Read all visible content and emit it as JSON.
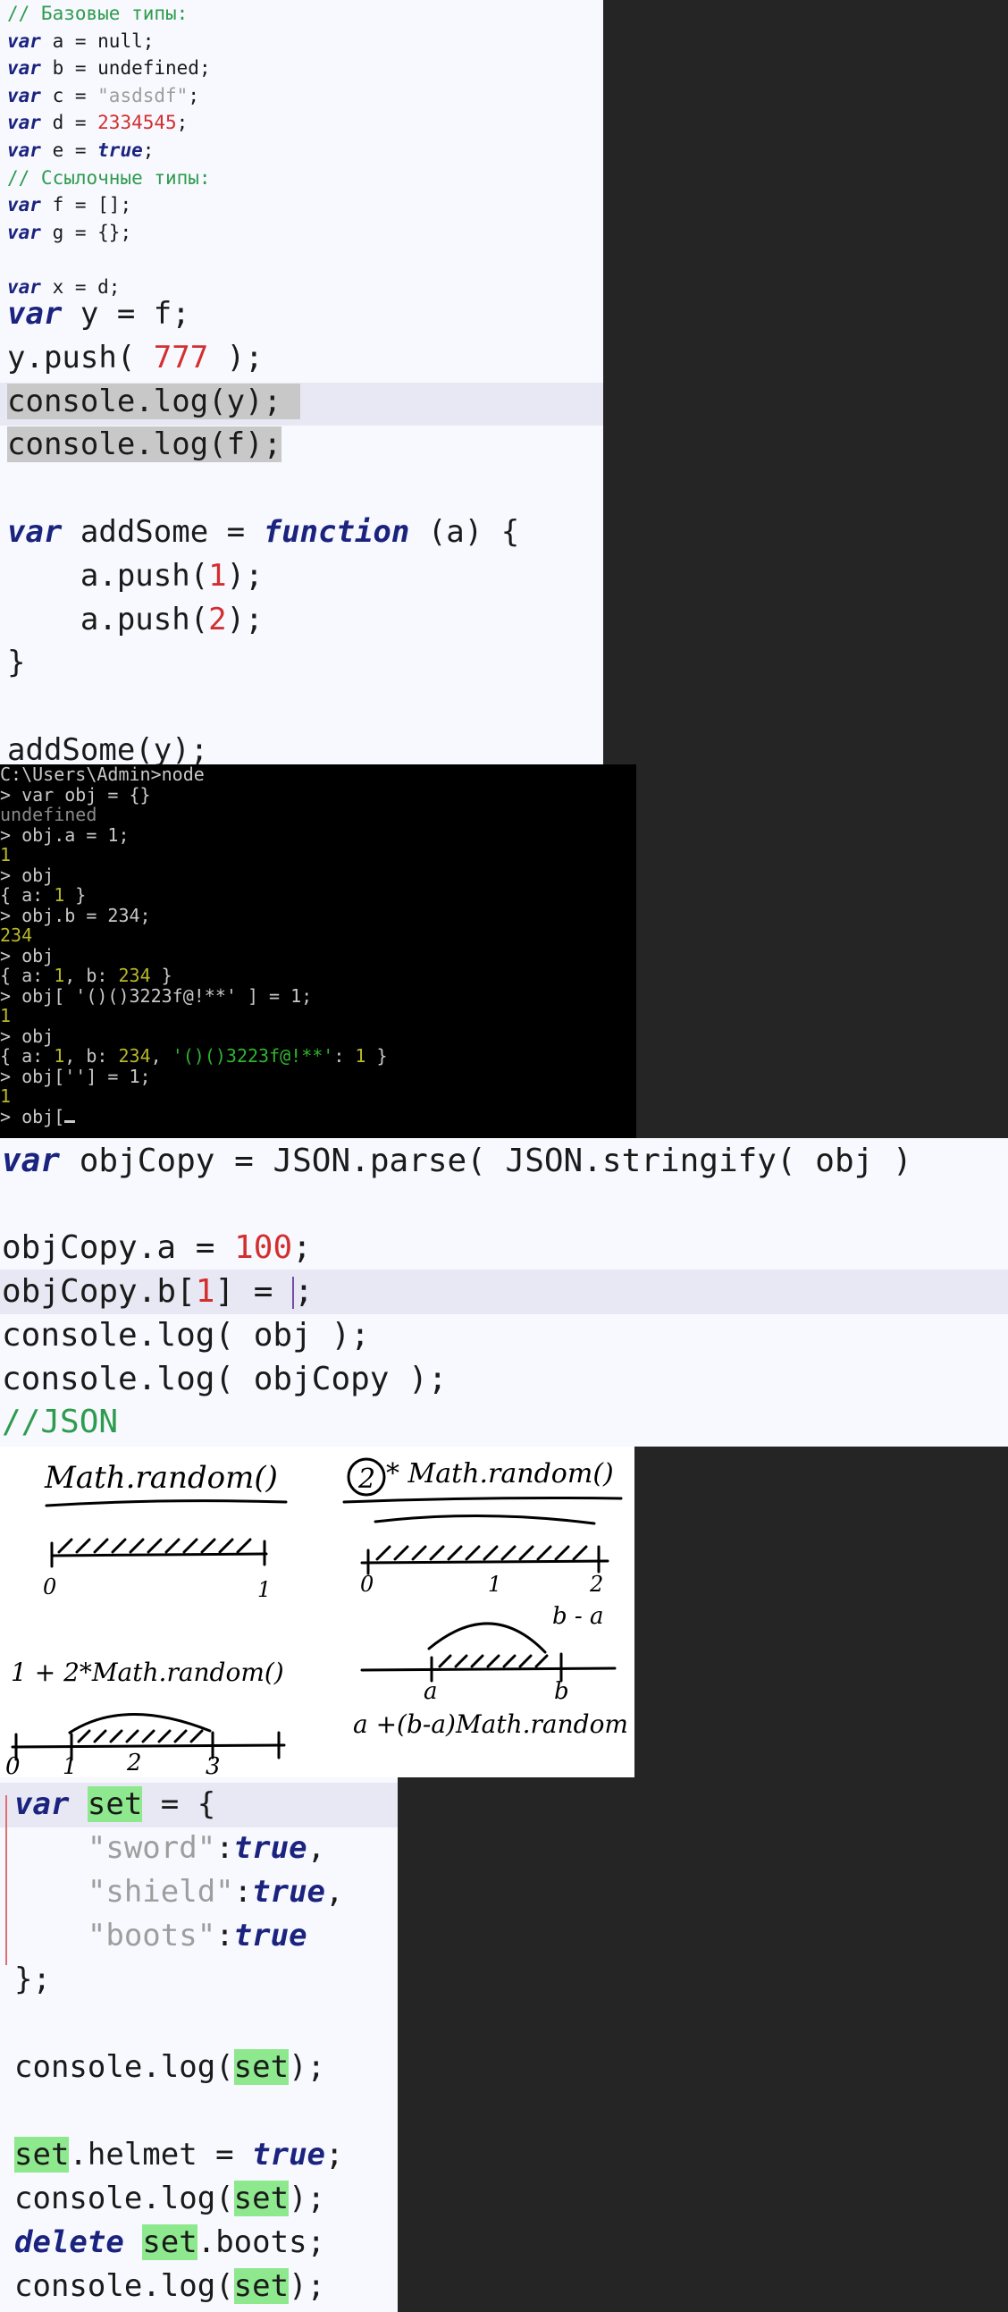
{
  "panel1": {
    "small_lines": [
      [
        [
          "cmt",
          "// Базовые типы:"
        ]
      ],
      [
        [
          "kw",
          "var"
        ],
        [
          "t",
          " a = null;"
        ]
      ],
      [
        [
          "kw",
          "var"
        ],
        [
          "t",
          " b = undefined;"
        ]
      ],
      [
        [
          "kw",
          "var"
        ],
        [
          "t",
          " c = "
        ],
        [
          "str",
          "\"asdsdf\""
        ],
        [
          "t",
          ";"
        ]
      ],
      [
        [
          "kw",
          "var"
        ],
        [
          "t",
          " d = "
        ],
        [
          "num",
          "2334545"
        ],
        [
          "t",
          ";"
        ]
      ],
      [
        [
          "kw",
          "var"
        ],
        [
          "t",
          " e = "
        ],
        [
          "kw",
          "true"
        ],
        [
          "t",
          ";"
        ]
      ],
      [
        [
          "cmt",
          "// Ссылочные типы:"
        ]
      ],
      [
        [
          "kw",
          "var"
        ],
        [
          "t",
          " f = [];"
        ]
      ],
      [
        [
          "kw",
          "var"
        ],
        [
          "t",
          " g = {};"
        ]
      ],
      [
        [
          "t",
          ""
        ]
      ],
      [
        [
          "kw",
          "var"
        ],
        [
          "t",
          " x = d;"
        ]
      ]
    ],
    "big_lines": [
      [
        [
          "kw",
          "var"
        ],
        [
          "t",
          " y = f;"
        ]
      ],
      [
        [
          "t",
          "y.push( "
        ],
        [
          "num",
          "777"
        ],
        [
          "t",
          " );"
        ]
      ],
      [
        [
          "sel",
          "console.log(y); "
        ]
      ],
      [
        [
          "sel",
          "console.log(f);"
        ]
      ],
      [
        [
          "t",
          ""
        ]
      ],
      [
        [
          "kw",
          "var"
        ],
        [
          "t",
          " addSome = "
        ],
        [
          "kw",
          "function"
        ],
        [
          "t",
          " (a) {"
        ]
      ],
      [
        [
          "t",
          "    a.push("
        ],
        [
          "num",
          "1"
        ],
        [
          "t",
          ");"
        ]
      ],
      [
        [
          "t",
          "    a.push("
        ],
        [
          "num",
          "2"
        ],
        [
          "t",
          ");"
        ]
      ],
      [
        [
          "t",
          "}"
        ]
      ],
      [
        [
          "t",
          ""
        ]
      ],
      [
        [
          "t",
          "addSome(y);"
        ]
      ]
    ]
  },
  "console": {
    "lines": [
      [
        [
          "t",
          "C:\\Users\\Admin>node"
        ]
      ],
      [
        [
          "t",
          "> var obj = {}"
        ]
      ],
      [
        [
          "g",
          "undefined"
        ]
      ],
      [
        [
          "t",
          "> obj.a = 1;"
        ]
      ],
      [
        [
          "y",
          "1"
        ]
      ],
      [
        [
          "t",
          "> obj"
        ]
      ],
      [
        [
          "t",
          "{ a: "
        ],
        [
          "y",
          "1"
        ],
        [
          "t",
          " }"
        ]
      ],
      [
        [
          "t",
          "> obj.b = 234;"
        ]
      ],
      [
        [
          "y",
          "234"
        ]
      ],
      [
        [
          "t",
          "> obj"
        ]
      ],
      [
        [
          "t",
          "{ a: "
        ],
        [
          "y",
          "1"
        ],
        [
          "t",
          ", b: "
        ],
        [
          "y",
          "234"
        ],
        [
          "t",
          " }"
        ]
      ],
      [
        [
          "t",
          "> obj[ '()()3223f@!**' ] = 1;"
        ]
      ],
      [
        [
          "y",
          "1"
        ]
      ],
      [
        [
          "t",
          "> obj"
        ]
      ],
      [
        [
          "t",
          "{ a: "
        ],
        [
          "y",
          "1"
        ],
        [
          "t",
          ", b: "
        ],
        [
          "y",
          "234"
        ],
        [
          "t",
          ", "
        ],
        [
          "gr",
          "'()()3223f@!**'"
        ],
        [
          "t",
          ": "
        ],
        [
          "y",
          "1"
        ],
        [
          "t",
          " }"
        ]
      ],
      [
        [
          "t",
          "> obj[''] = 1;"
        ]
      ],
      [
        [
          "y",
          "1"
        ]
      ],
      [
        [
          "t",
          "> obj["
        ],
        [
          "cur",
          ""
        ]
      ]
    ]
  },
  "panel3": {
    "lines": [
      [
        [
          "kw",
          "var"
        ],
        [
          "t",
          " objCopy = JSON.parse( JSON.stringify( obj )"
        ]
      ],
      [
        [
          "t",
          ""
        ]
      ],
      [
        [
          "t",
          "objCopy.a = "
        ],
        [
          "num",
          "100"
        ],
        [
          "t",
          ";"
        ]
      ],
      [
        [
          "t",
          "objCopy.b["
        ],
        [
          "num",
          "1"
        ],
        [
          "t",
          "] = "
        ],
        [
          "caret",
          ""
        ],
        [
          "t",
          ";"
        ]
      ],
      [
        [
          "t",
          "console.log( obj );"
        ]
      ],
      [
        [
          "t",
          "console.log( objCopy );"
        ]
      ],
      [
        [
          "cmt",
          "//JSON"
        ]
      ]
    ]
  },
  "drawing": {
    "labels": {
      "top_left": "Math.random()",
      "top_right_circle": "2",
      "top_right": "* Math.random()",
      "bottom_left": "1 + 2*Math.random()",
      "bottom_right": "a +(b-a)Math.random",
      "b_minus_a": "b - a",
      "a": "a",
      "b": "b"
    },
    "ticks": {
      "tl": [
        "0",
        "1"
      ],
      "tr": [
        "0",
        "1",
        "2"
      ],
      "bl": [
        "0",
        "1",
        "2",
        "3"
      ]
    }
  },
  "panel5": {
    "lines": [
      [
        [
          "kw",
          "var"
        ],
        [
          "t",
          " "
        ],
        [
          "match",
          "set"
        ],
        [
          "t",
          " = {"
        ]
      ],
      [
        [
          "t",
          "    "
        ],
        [
          "str",
          "\"sword\""
        ],
        [
          "t",
          ":"
        ],
        [
          "kw",
          "true"
        ],
        [
          "t",
          ","
        ]
      ],
      [
        [
          "t",
          "    "
        ],
        [
          "str",
          "\"shield\""
        ],
        [
          "t",
          ":"
        ],
        [
          "kw",
          "true"
        ],
        [
          "t",
          ","
        ]
      ],
      [
        [
          "t",
          "    "
        ],
        [
          "str",
          "\"boots\""
        ],
        [
          "t",
          ":"
        ],
        [
          "kw",
          "true"
        ]
      ],
      [
        [
          "t",
          "};"
        ]
      ],
      [
        [
          "t",
          ""
        ]
      ],
      [
        [
          "t",
          "console.log("
        ],
        [
          "match",
          "set"
        ],
        [
          "t",
          ");"
        ]
      ],
      [
        [
          "t",
          ""
        ]
      ],
      [
        [
          "match",
          "set"
        ],
        [
          "t",
          ".helmet = "
        ],
        [
          "kw",
          "true"
        ],
        [
          "t",
          ";"
        ]
      ],
      [
        [
          "t",
          "console.log("
        ],
        [
          "match",
          "set"
        ],
        [
          "t",
          ");"
        ]
      ],
      [
        [
          "kw",
          "delete"
        ],
        [
          "t",
          " "
        ],
        [
          "match",
          "set"
        ],
        [
          "t",
          ".boots;"
        ]
      ],
      [
        [
          "t",
          "console.log("
        ],
        [
          "match",
          "set"
        ],
        [
          "t",
          ");"
        ]
      ]
    ]
  }
}
